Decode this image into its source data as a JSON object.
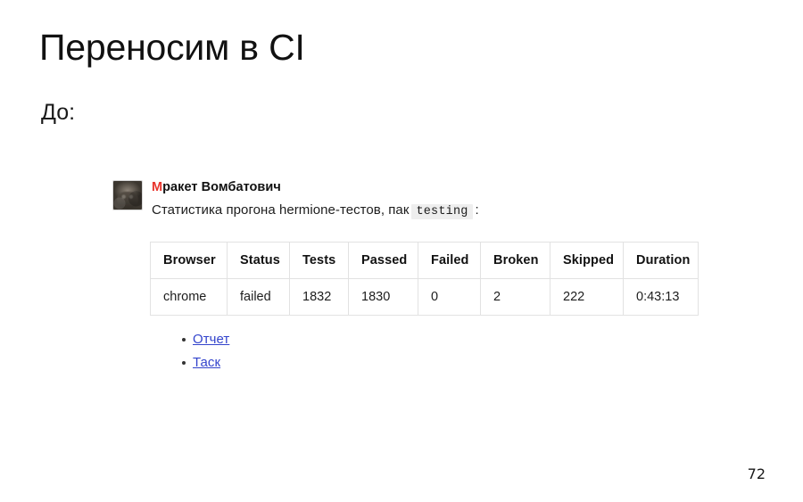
{
  "slide": {
    "title": "Переносим в CI",
    "subtitle": "До:",
    "page_number": "72"
  },
  "chat": {
    "avatar_icon": "wombat-avatar-icon",
    "sender_initial": "М",
    "sender_name_rest": "ракет Вомбатович",
    "sender_name_full": "Мракет Вомбатович",
    "message_prefix": "Статистика прогона hermione-тестов, пак",
    "message_code": "testing",
    "message_suffix": ":",
    "links": [
      {
        "label": "Отчет"
      },
      {
        "label": "Таск"
      }
    ]
  },
  "table": {
    "headers": [
      "Browser",
      "Status",
      "Tests",
      "Passed",
      "Failed",
      "Broken",
      "Skipped",
      "Duration"
    ],
    "rows": [
      {
        "browser": "chrome",
        "status": "failed",
        "tests": "1832",
        "passed": "1830",
        "failed": "0",
        "broken": "2",
        "skipped": "222",
        "duration": "0:43:13"
      }
    ]
  },
  "colors": {
    "status_failed": "#e8332b",
    "tests_link": "#3b78e7",
    "passed_ok": "#17883a",
    "failed_zero": "#e8332b",
    "broken_warn": "#ffcc33",
    "skipped_muted": "#9a9a9a",
    "sender_initial": "#e8332b",
    "link": "#3344cc",
    "table_border": "#e2e2e2",
    "background": "#ffffff"
  }
}
